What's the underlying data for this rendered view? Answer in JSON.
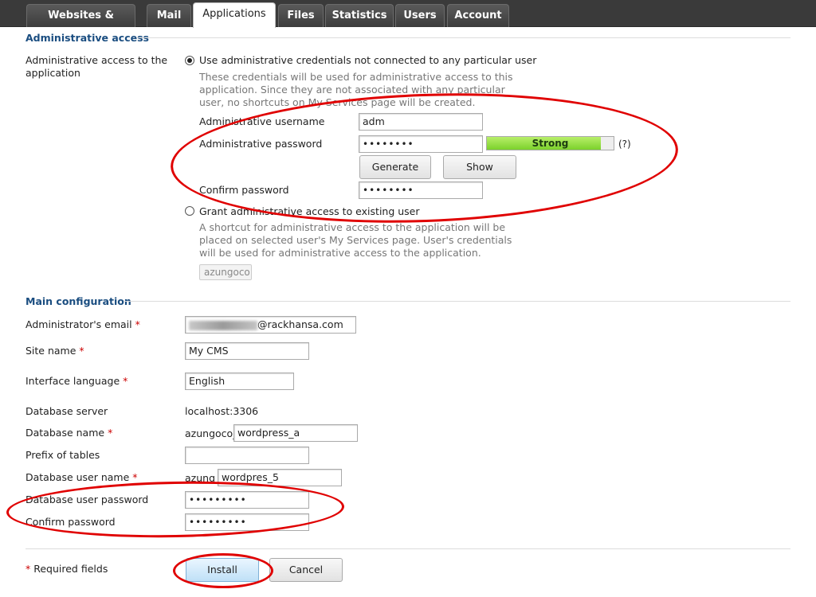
{
  "tabs": [
    {
      "label": "Websites & Domains"
    },
    {
      "label": "Mail"
    },
    {
      "label": "Applications"
    },
    {
      "label": "Files"
    },
    {
      "label": "Statistics"
    },
    {
      "label": "Users"
    },
    {
      "label": "Account"
    }
  ],
  "admin_access": {
    "section_title": "Administrative access",
    "label": "Administrative access to the application",
    "option1": {
      "label": "Use administrative credentials not connected to any particular user",
      "hint": "These credentials will be used for administrative access to this application. Since they are not associated with any particular user, no shortcuts on My Services page will be created.",
      "selected": true
    },
    "username_label": "Administrative username",
    "username_value": "adm",
    "password_label": "Administrative password",
    "password_value": "••••••••",
    "strength_text": "Strong",
    "strength_level": 0.9,
    "strength_help": "(?)",
    "generate_label": "Generate",
    "show_label": "Show",
    "confirm_label": "Confirm password",
    "confirm_value": "••••••••",
    "option2": {
      "label": "Grant administrative access to existing user",
      "hint": "A shortcut for administrative access to the application will be placed on selected user's My Services page. User's credentials will be used for administrative access to the application.",
      "selected": false
    },
    "user_select_value": "azungoco"
  },
  "main_config": {
    "section_title": "Main configuration",
    "email_label": "Administrator's email",
    "email_value": "@rackhansa.com",
    "site_name_label": "Site name",
    "site_name_value": "My CMS",
    "language_label": "Interface language",
    "language_value": "English",
    "db_server_label": "Database server",
    "db_server_value": "localhost:3306",
    "db_name_label": "Database name",
    "db_name_prefix": "azungoco_",
    "db_name_value": "wordpress_a",
    "prefix_label": "Prefix of tables",
    "prefix_value": "",
    "db_user_label": "Database user name",
    "db_user_prefix": "azung",
    "db_user_value": "wordpres_5",
    "db_pass_label": "Database user password",
    "db_pass_value": "•••••••••",
    "db_confirm_label": "Confirm password",
    "db_confirm_value": "•••••••••",
    "required_marker": "*"
  },
  "footer": {
    "required_note": "Required fields",
    "install_label": "Install",
    "cancel_label": "Cancel"
  },
  "colors": {
    "tabbar_bg": "#3a3a3a",
    "section_title": "#1a4d80",
    "annotation": "#e00000",
    "strength_fill": "#7bd12b"
  }
}
